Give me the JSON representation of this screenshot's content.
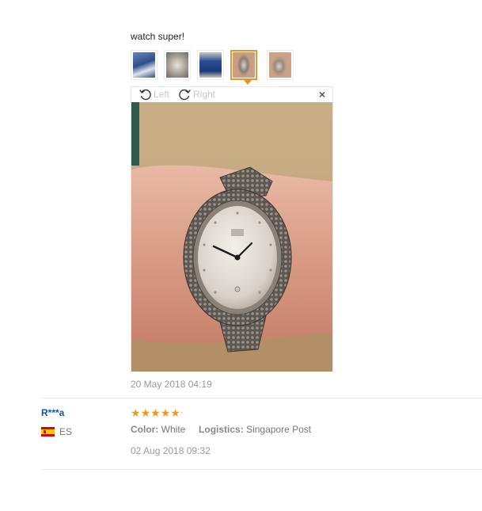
{
  "review1": {
    "text": "watch super!",
    "thumbnails": [
      {
        "name": "thumb-1",
        "color": "#2c4f8a"
      },
      {
        "name": "thumb-2",
        "color": "#b7b0a8"
      },
      {
        "name": "thumb-3",
        "color": "#2a4f96"
      },
      {
        "name": "thumb-4",
        "color": "#8a7f73",
        "active": true
      },
      {
        "name": "thumb-5",
        "color": "#9a8a7c"
      }
    ],
    "viewer": {
      "rotate_left_label": "Left",
      "rotate_right_label": "Right",
      "close_symbol": "×"
    },
    "date": "20 May 2018 04:19"
  },
  "review2": {
    "reviewer_name": "R***a",
    "country_code": "ES",
    "rating_stars": 5,
    "color_label": "Color:",
    "color_value": "White",
    "logistics_label": "Logistics:",
    "logistics_value": "Singapore Post",
    "date": "02 Aug 2018 09:32"
  },
  "colors": {
    "accent": "#e8962b",
    "name_link": "#0a58a8",
    "star": "#f09a1a"
  }
}
